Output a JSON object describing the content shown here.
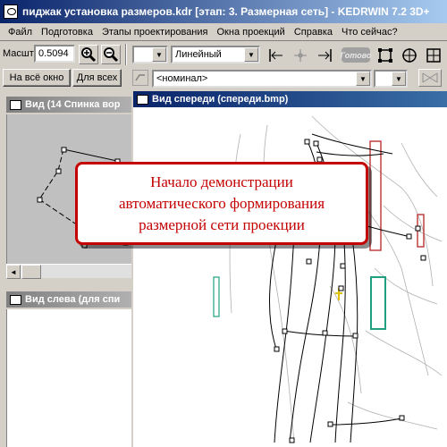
{
  "window": {
    "title": "пиджак установка размеров.kdr [этап: 3. Размерная сеть] - KEDRWIN 7.2 3D+"
  },
  "menu": [
    "Файл",
    "Подготовка",
    "Этапы проектирования",
    "Окна проекций",
    "Справка",
    "Что сейчас?"
  ],
  "toolbar": {
    "scale_label": "Масшт",
    "scale_value": "0.5094",
    "zoom_in_icon": "zoom-in-icon",
    "zoom_out_icon": "zoom-out-icon",
    "combo_empty": "",
    "line_type": "Линейный",
    "ready_label": "Готово",
    "fit_button": "На всё окно",
    "all_button": "Для всех",
    "nominal": "<номинал>"
  },
  "views": {
    "back": {
      "title": "Вид (14 Спинка вор"
    },
    "left": {
      "title": "Вид слева (для спи"
    },
    "front": {
      "title": "Вид спереди (спереди.bmp)"
    }
  },
  "callout": {
    "text": "Начало демонстрации\nавтоматического формирования\nразмерной сети проекции"
  },
  "colors": {
    "title_active": "#0a246a",
    "callout_red": "#c40000",
    "pattern_red": "#c04040",
    "pattern_teal": "#20a080"
  }
}
